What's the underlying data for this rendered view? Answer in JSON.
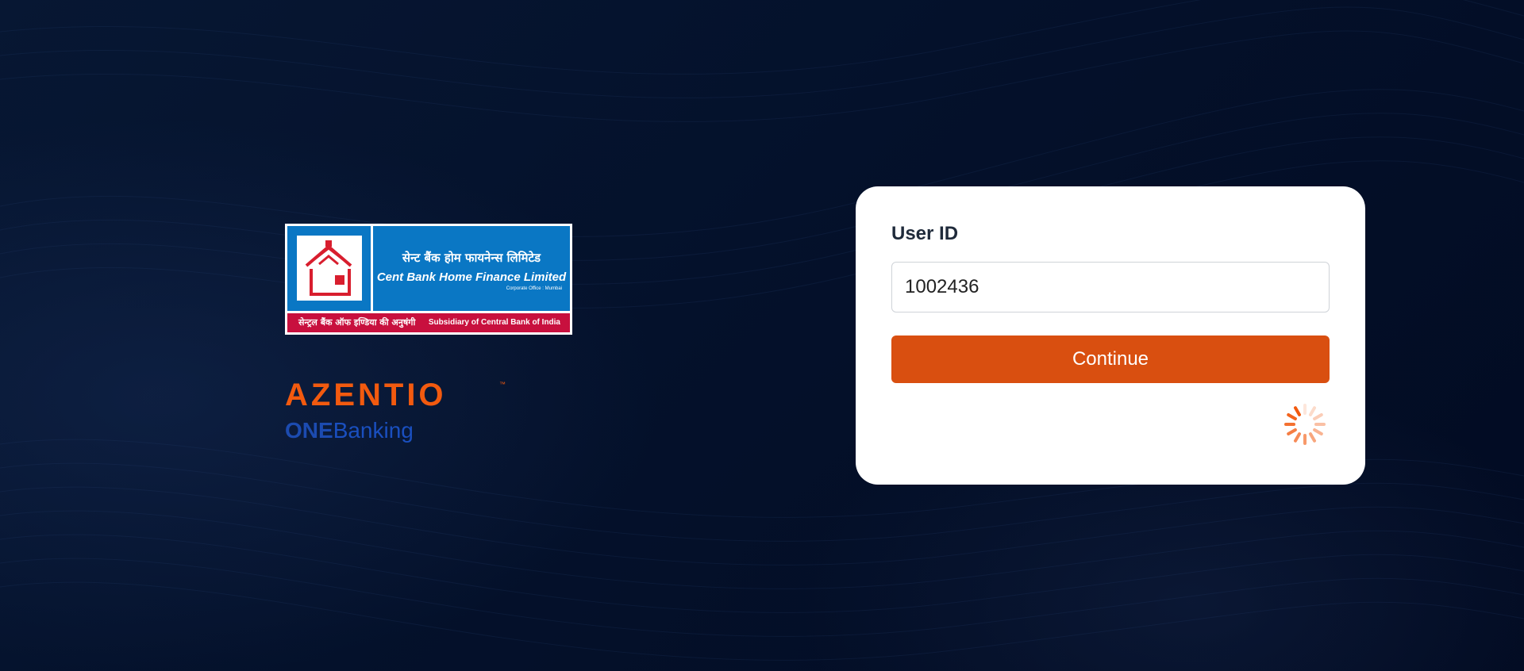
{
  "branding": {
    "cbhfl_logo": {
      "hindi_name": "सेन्ट बैंक होम फायनेन्स लिमिटेड",
      "english_name": "Cent Bank Home Finance Limited",
      "office": "Corporate Office : Mumbai",
      "hindi_subsidiary": "सेन्ट्रल बैंक ऑफ इण्डिया की अनुषंगी",
      "english_subsidiary": "Subsidiary of Central Bank of India"
    },
    "azentio": {
      "wordmark": "AZENTIO",
      "trademark": "™",
      "product_one": "ONE",
      "product_banking": "Banking"
    }
  },
  "login": {
    "user_id_label": "User ID",
    "user_id_value": "1002436",
    "continue_label": "Continue"
  },
  "colors": {
    "background": "#04102a",
    "primary_button": "#d94f10",
    "azentio_orange": "#f25a0f",
    "onebanking_blue": "#1c4bb0",
    "logo_blue": "#0a77c4",
    "logo_red": "#c8103e"
  }
}
